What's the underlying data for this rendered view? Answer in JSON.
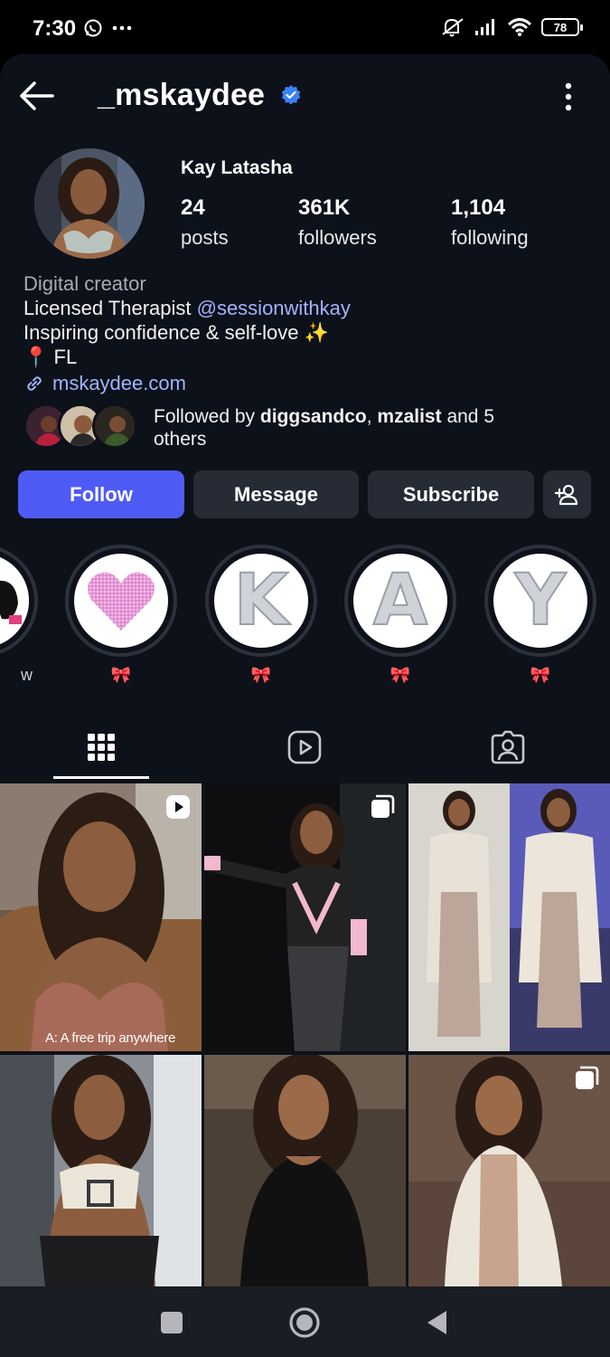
{
  "status_bar": {
    "time": "7:30",
    "battery": "78",
    "icons": [
      "whatsapp-icon",
      "more-dots-icon",
      "mute-icon",
      "signal-icon",
      "wifi-icon",
      "battery-icon"
    ]
  },
  "header": {
    "username": "_mskaydee",
    "verified": true
  },
  "profile": {
    "full_name": "Kay Latasha",
    "stats": [
      {
        "value": "24",
        "label": "posts"
      },
      {
        "value": "361K",
        "label": "followers"
      },
      {
        "value": "1,104",
        "label": "following"
      }
    ],
    "category": "Digital creator",
    "bio_line1_prefix": "Licensed Therapist ",
    "bio_mention": "@sessionwithkay",
    "bio_line2": "Inspiring confidence & self-love ✨",
    "location": "📍 FL",
    "link": "mskaydee.com",
    "followed_by_prefix": "Followed by ",
    "followed_by_user1": "diggsandco",
    "followed_by_sep": ", ",
    "followed_by_user2": "mzalist",
    "followed_by_suffix": " and 5 others"
  },
  "actions": {
    "follow": "Follow",
    "message": "Message",
    "subscribe": "Subscribe"
  },
  "highlights": [
    {
      "label": "w",
      "partial": true
    },
    {
      "label": "🎀",
      "content": "heart"
    },
    {
      "label": "🎀",
      "content": "K"
    },
    {
      "label": "🎀",
      "content": "A"
    },
    {
      "label": "🎀",
      "content": "Y"
    }
  ],
  "tabs": [
    "grid-icon",
    "reels-icon",
    "tagged-icon"
  ],
  "posts": [
    {
      "caption": "A: A free trip anywhere",
      "badge": "reel-icon"
    },
    {
      "caption": "",
      "badge": "carousel-icon"
    },
    {
      "caption": "",
      "badge": ""
    },
    {
      "caption": "",
      "badge": ""
    },
    {
      "caption": "",
      "badge": ""
    },
    {
      "caption": "",
      "badge": "carousel-icon"
    }
  ],
  "colors": {
    "accent": "#4f5bf5",
    "background": "#0d111a",
    "button": "#262b35",
    "link": "#a0b4ff",
    "verified": "#3b82f6"
  }
}
